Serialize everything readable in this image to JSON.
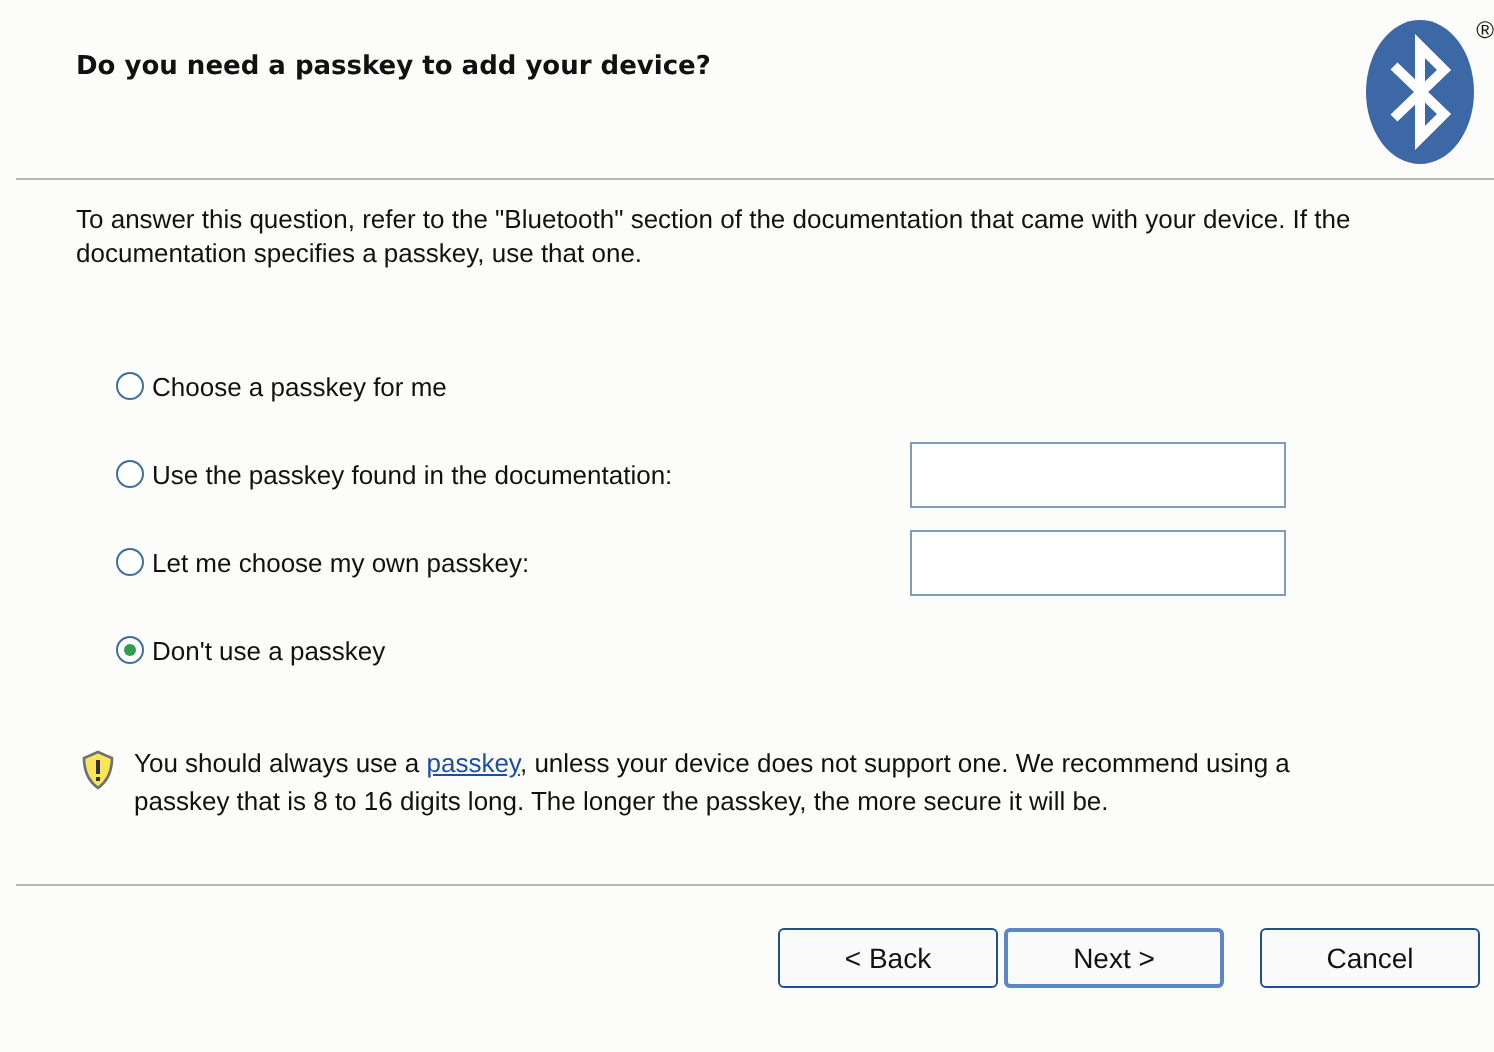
{
  "header": {
    "title": "Do you need a passkey to add your device?",
    "logo_mark": "®"
  },
  "intro": "To answer this question, refer to the \"Bluetooth\" section of the documentation that came with your device. If the documentation specifies a passkey, use that one.",
  "options": [
    {
      "label": "Choose a passkey for me",
      "kind": "plain",
      "selected": false
    },
    {
      "label": "Use the passkey found in the documentation:",
      "kind": "with_field",
      "selected": false
    },
    {
      "label": "Let me choose my own passkey:",
      "kind": "with_field",
      "selected": false
    },
    {
      "label": "Don't use a passkey",
      "kind": "plain",
      "selected": true
    }
  ],
  "warning": {
    "before": "You should always use a ",
    "link": "passkey",
    "after": ", unless your device does not support one. We recommend using a passkey that is 8 to 16 digits long. The longer the passkey, the more secure it will be."
  },
  "buttons": [
    {
      "label": "< Back",
      "default": false
    },
    {
      "label": "Next >",
      "default": true
    },
    {
      "label": "Cancel",
      "default": false
    }
  ]
}
